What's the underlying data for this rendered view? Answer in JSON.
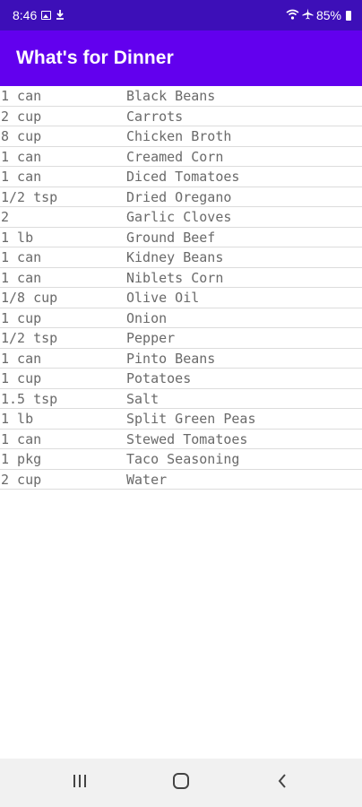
{
  "status_bar": {
    "time": "8:46",
    "battery": "85%",
    "icons": [
      "gallery-icon",
      "download-icon",
      "wifi-icon",
      "airplane-icon",
      "battery-icon"
    ]
  },
  "app_bar": {
    "title": "What's for Dinner",
    "color": "#6200ee"
  },
  "ingredients": [
    {
      "qty": "1 can",
      "name": "Black Beans"
    },
    {
      "qty": "2 cup",
      "name": "Carrots"
    },
    {
      "qty": "8 cup",
      "name": "Chicken Broth"
    },
    {
      "qty": "1 can",
      "name": "Creamed Corn"
    },
    {
      "qty": "1 can",
      "name": "Diced Tomatoes"
    },
    {
      "qty": "1/2 tsp",
      "name": "Dried Oregano"
    },
    {
      "qty": "2",
      "name": "Garlic Cloves"
    },
    {
      "qty": "1 lb",
      "name": "Ground Beef"
    },
    {
      "qty": "1 can",
      "name": "Kidney Beans"
    },
    {
      "qty": "1 can",
      "name": "Niblets Corn"
    },
    {
      "qty": "1/8 cup",
      "name": "Olive Oil"
    },
    {
      "qty": "1 cup",
      "name": "Onion"
    },
    {
      "qty": "1/2 tsp",
      "name": "Pepper"
    },
    {
      "qty": "1 can",
      "name": "Pinto Beans"
    },
    {
      "qty": "1 cup",
      "name": "Potatoes"
    },
    {
      "qty": "1.5 tsp",
      "name": "Salt"
    },
    {
      "qty": "1 lb",
      "name": "Split Green Peas"
    },
    {
      "qty": "1 can",
      "name": "Stewed Tomatoes"
    },
    {
      "qty": "1 pkg",
      "name": "Taco Seasoning"
    },
    {
      "qty": "2 cup",
      "name": "Water"
    }
  ],
  "nav_bar": {
    "icons": [
      "recent-apps-icon",
      "home-icon",
      "back-icon"
    ]
  }
}
